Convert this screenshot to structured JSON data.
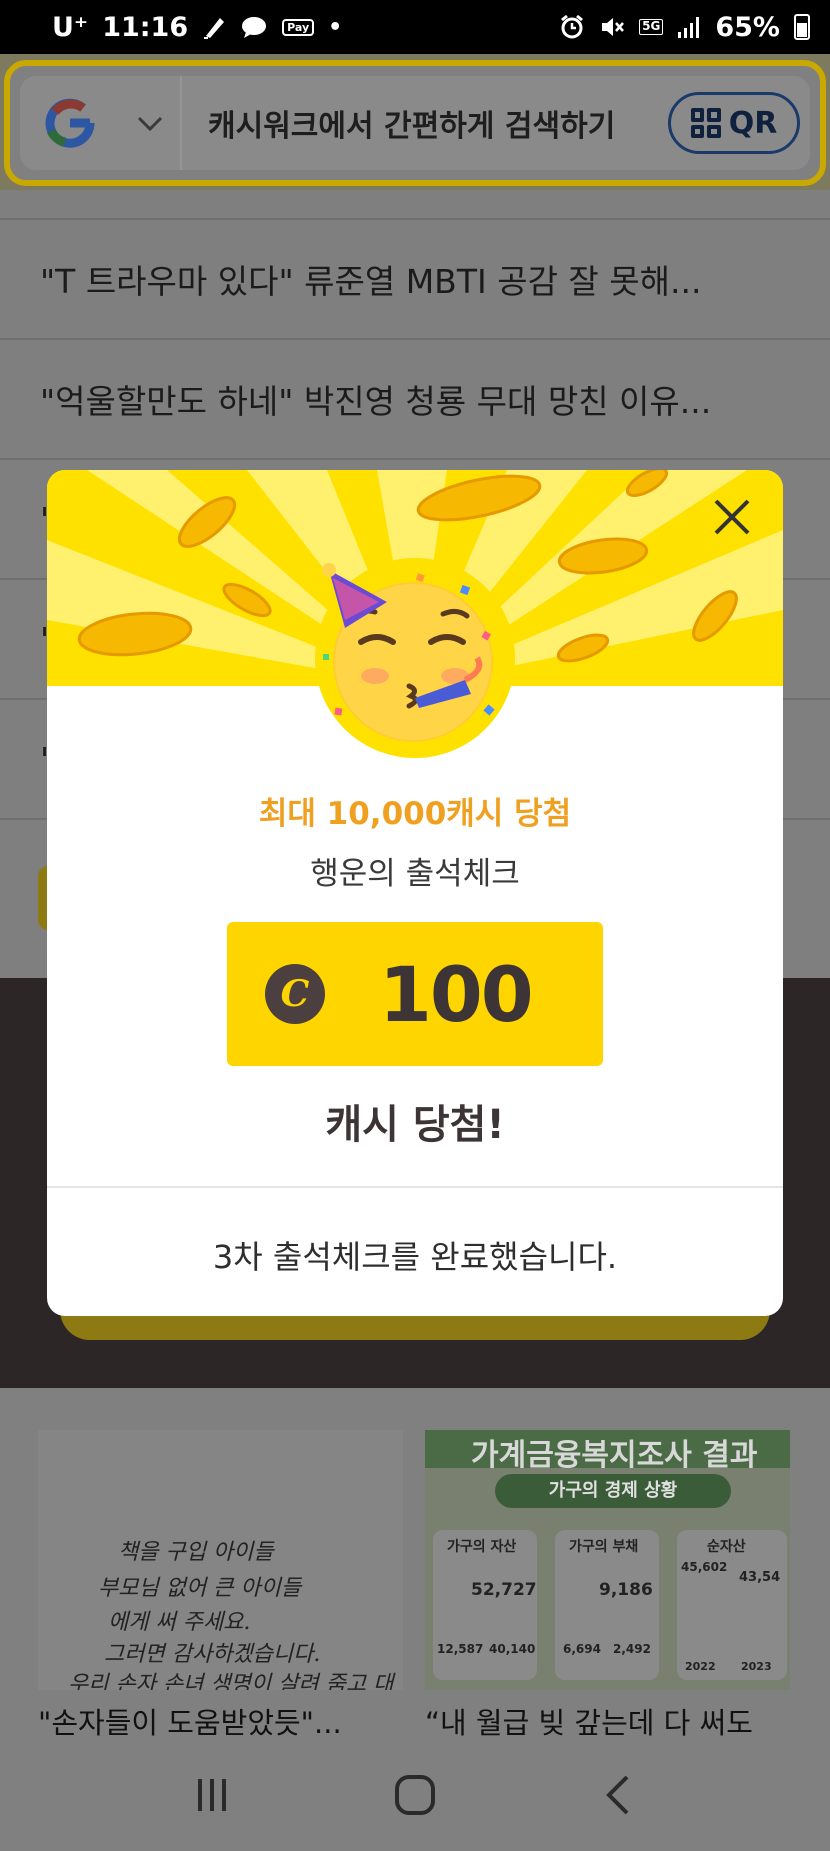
{
  "status_bar": {
    "carrier": "U⁺",
    "time": "11:16",
    "pay_badge": "Pay",
    "network": "5G",
    "battery": "65%",
    "icons": [
      "pen-icon",
      "chat-icon",
      "pay-icon",
      "dot-icon",
      "alarm-icon",
      "mute-icon",
      "5g-icon",
      "signal-icon",
      "battery-icon"
    ]
  },
  "search": {
    "engine": "G",
    "placeholder": "캐시워크에서 간편하게 검색하기",
    "qr_label": "QR"
  },
  "news": {
    "items": [
      "\"T 트라우마 있다\" 류준열 MBTI 공감 잘 못해...",
      "\"억울할만도 하네\" 박진영 청룡 무대 망친 이유...",
      "\"",
      "\"",
      "\""
    ]
  },
  "cards": {
    "left_caption": "\"손자들이 도움받았듯\"...",
    "left_handwriting": [
      "책을 구입 아이들",
      "부모님 없어 큰 아이들",
      "에게 써 주세요.",
      "그러면 감사하겠습니다.",
      "우리 손자 손녀 생명이 살려 줌고 대어"
    ],
    "right_caption": "“내 월급 빚 갚는데 다 써도",
    "right_title": "가계금융복지조사 결과",
    "right_subtitle": "가구의 경제 상황",
    "right_labels": [
      "가구의 자산",
      "가구의 부채",
      "순자산"
    ],
    "right_values": [
      "52,727",
      "9,186",
      "45,602",
      "43,54"
    ],
    "right_small": [
      "12,587",
      "40,140",
      "6,694",
      "2,492",
      "2022",
      "2023"
    ]
  },
  "modal": {
    "win_range": "최대 10,000캐시 당첨",
    "title": "행운의 출석체크",
    "coin_symbol": "C",
    "amount": "100",
    "win_label": "캐시 당첨!",
    "done_message": "3차 출석체크를 완료했습니다."
  },
  "colors": {
    "hero_yellow": "#ffe100",
    "prize_yellow": "#ffd500",
    "accent_orange": "#f0a020",
    "text_dark": "#3d3535"
  }
}
